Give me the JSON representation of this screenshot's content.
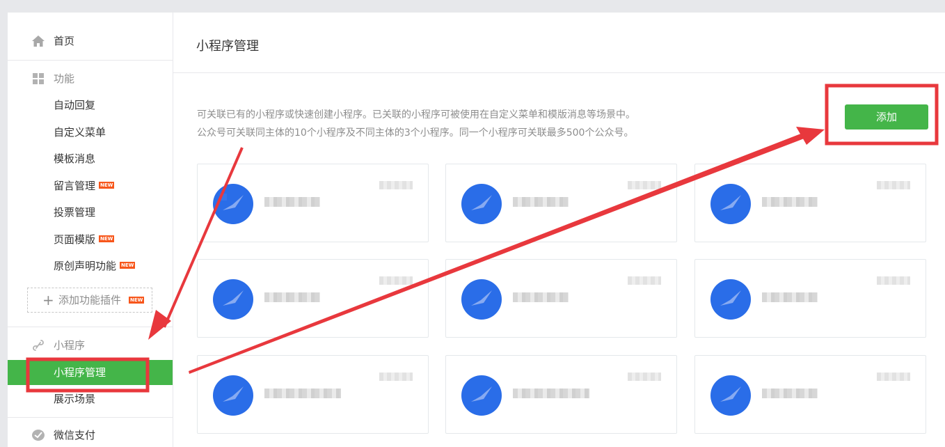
{
  "sidebar": {
    "home": "首页",
    "features_header": "功能",
    "features": [
      {
        "label": "自动回复",
        "new": ""
      },
      {
        "label": "自定义菜单",
        "new": ""
      },
      {
        "label": "模板消息",
        "new": ""
      },
      {
        "label": "留言管理",
        "new": "NEW"
      },
      {
        "label": "投票管理",
        "new": ""
      },
      {
        "label": "页面模版",
        "new": "NEW"
      },
      {
        "label": "原创声明功能",
        "new": "NEW"
      }
    ],
    "add_plugin": {
      "plus": "+",
      "label": "添加功能插件",
      "new": "NEW"
    },
    "miniprogram_header": "小程序",
    "miniprogram_items": [
      "小程序管理",
      "展示场景"
    ],
    "pay": "微信支付"
  },
  "main": {
    "title": "小程序管理",
    "description": [
      "可关联已有的小程序或快速创建小程序。已关联的小程序可被使用在自定义菜单和模版消息等场景中。",
      "公众号可关联同主体的10个小程序及不同主体的3个小程序。同一个小程序可关联最多500个公众号。"
    ],
    "add_button": "添加"
  },
  "colors": {
    "accent": "#44b549",
    "annotation_red": "#e8383d",
    "avatar_blue": "#2a6de8",
    "new_badge": "#f7561b"
  }
}
